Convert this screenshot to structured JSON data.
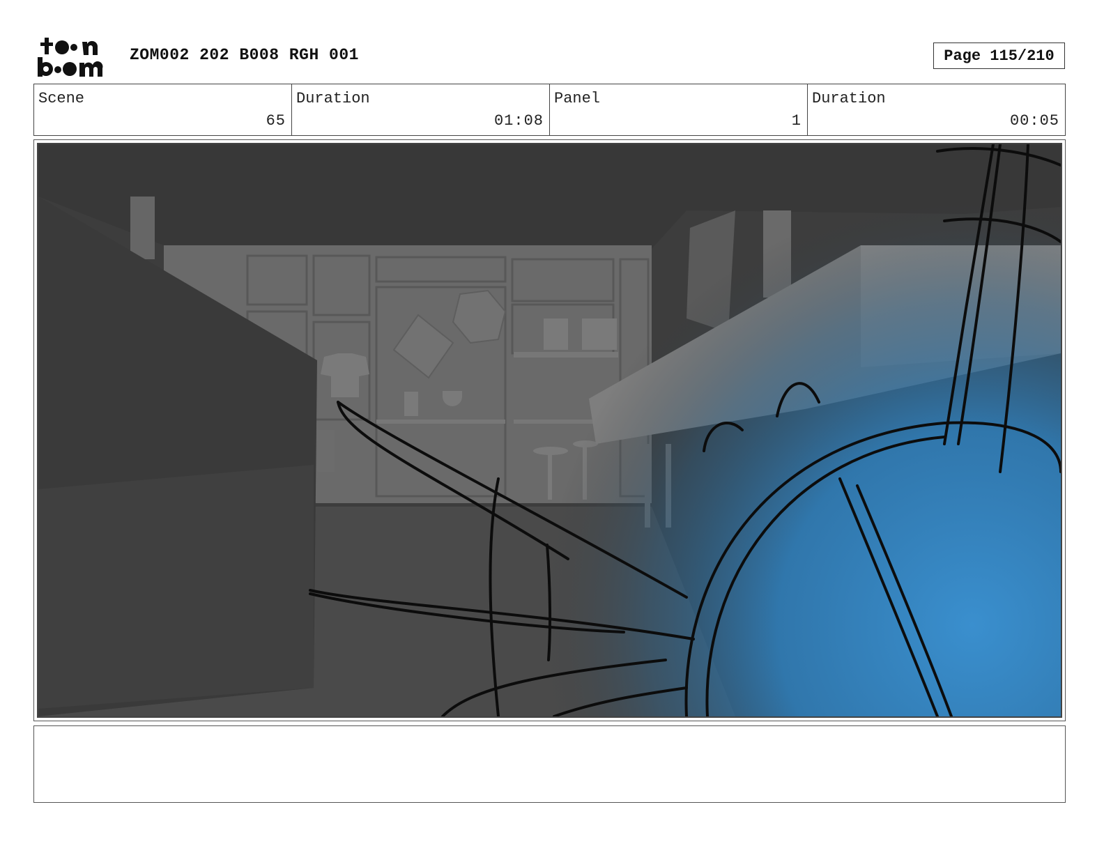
{
  "header": {
    "logo_text": "toon boom",
    "document_title": "ZOM002 202 B008 RGH 001",
    "page_label": "Page 115/210"
  },
  "info": {
    "scene_label": "Scene",
    "scene_value": "65",
    "scene_duration_label": "Duration",
    "scene_duration_value": "01:08",
    "panel_label": "Panel",
    "panel_value": "1",
    "panel_duration_label": "Duration",
    "panel_duration_value": "00:05"
  },
  "panel": {
    "glow_color": "#3a8fce"
  },
  "notes": {
    "text": ""
  }
}
